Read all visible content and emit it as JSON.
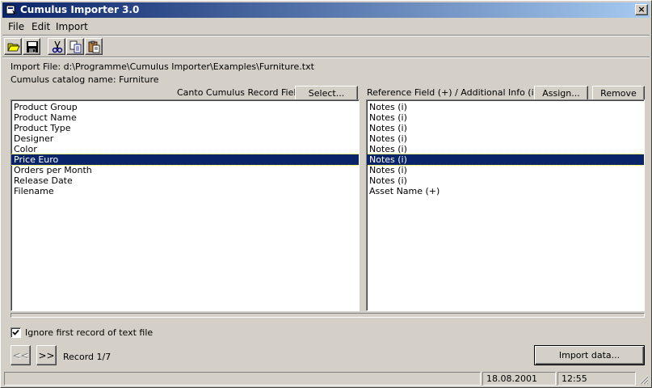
{
  "window": {
    "title": "Cumulus Importer 3.0",
    "close_glyph": "×"
  },
  "menu": {
    "items": [
      "File",
      "Edit",
      "Import"
    ]
  },
  "toolbar": {
    "icons": [
      "open-folder-icon",
      "save-icon",
      "cut-icon",
      "copy-icon",
      "paste-icon"
    ]
  },
  "info": {
    "import_file": "Import File: d:\\Programme\\Cumulus Importer\\Examples\\Furniture.txt",
    "catalog_name": "Cumulus catalog name: Furniture"
  },
  "left_panel": {
    "header": "Canto Cumulus Record Fields",
    "select_label": "Select...",
    "items": [
      "Product Group",
      "Product Name",
      "Product Type",
      "Designer",
      "Color",
      "Price Euro",
      "Orders per Month",
      "Release Date",
      "Filename"
    ],
    "selected_index": 5
  },
  "right_panel": {
    "header": "Reference Field (+) / Additional Info (i)",
    "assign_label": "Assign...",
    "remove_label": "Remove",
    "items": [
      "Notes (i)",
      "Notes (i)",
      "Notes (i)",
      "Notes (i)",
      "Notes (i)",
      "Notes (i)",
      "Notes (i)",
      "Notes (i)",
      "Asset Name (+)"
    ],
    "selected_index": 5
  },
  "options": {
    "ignore_first_label": "Ignore first record of text file",
    "ignore_first_checked": true
  },
  "nav": {
    "prev_label": "<<",
    "next_label": ">>",
    "record_label": "Record 1/7"
  },
  "actions": {
    "import_label": "Import data..."
  },
  "status": {
    "main": "",
    "date": "18.08.2001",
    "time": "12:55"
  },
  "colors": {
    "selection": "#0a246a",
    "face": "#d4d0c8",
    "title_start": "#0a246a",
    "title_end": "#a6caf0"
  }
}
